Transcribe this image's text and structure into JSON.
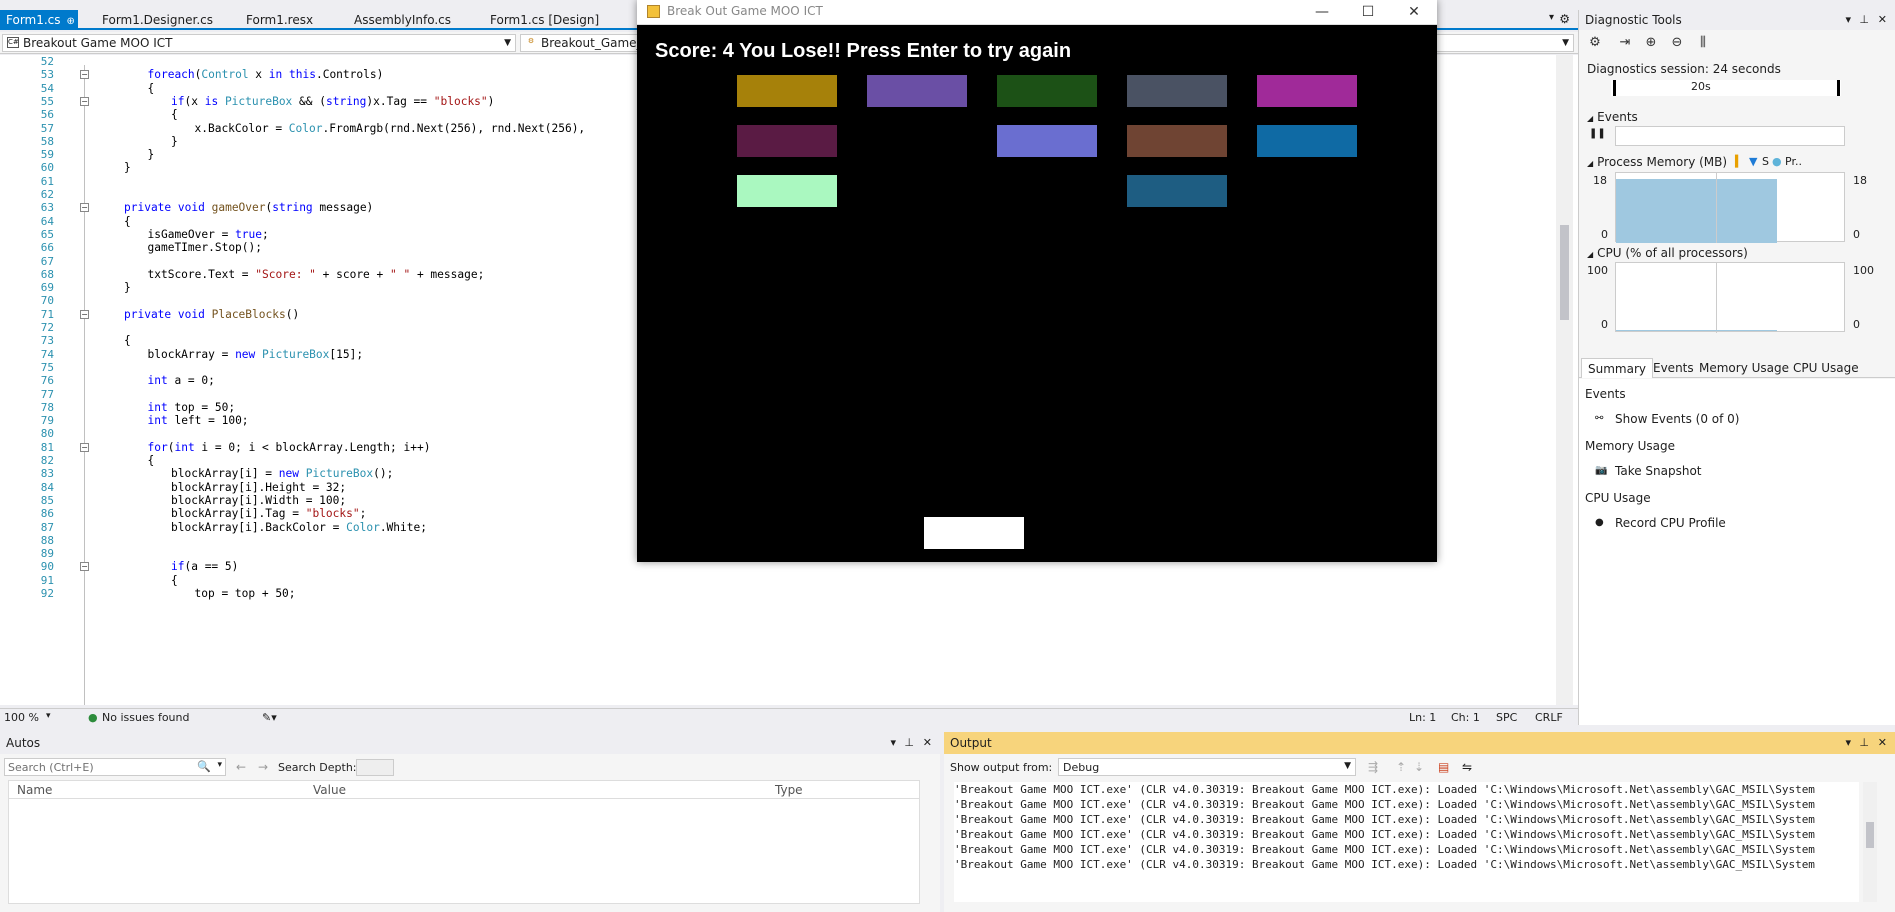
{
  "tabs": [
    {
      "label": "Form1.cs",
      "active": true
    },
    {
      "label": "Form1.Designer.cs"
    },
    {
      "label": "Form1.resx"
    },
    {
      "label": "AssemblyInfo.cs"
    },
    {
      "label": "Form1.cs [Design]"
    }
  ],
  "navbar": {
    "project": "Breakout Game MOO ICT",
    "class": "Breakout_Game_M"
  },
  "code_lines": [
    {
      "n": "52",
      "indent": 0,
      "html": ""
    },
    {
      "n": "53",
      "indent": 2,
      "html": "<span class='kw'>foreach</span>(<span class='ty'>Control</span> x <span class='kw'>in</span> <span class='kw'>this</span>.Controls)"
    },
    {
      "n": "54",
      "indent": 2,
      "html": "{"
    },
    {
      "n": "55",
      "indent": 3,
      "html": "<span class='kw'>if</span>(x <span class='kw'>is</span> <span class='ty'>PictureBox</span> &amp;&amp; (<span class='kw'>string</span>)x.Tag == <span class='st'>\"blocks\"</span>)"
    },
    {
      "n": "56",
      "indent": 3,
      "html": "{"
    },
    {
      "n": "57",
      "indent": 4,
      "html": "x.BackColor = <span class='ty'>Color</span>.FromArgb(rnd.Next(256), rnd.Next(256),"
    },
    {
      "n": "58",
      "indent": 3,
      "html": "}"
    },
    {
      "n": "59",
      "indent": 2,
      "html": "}"
    },
    {
      "n": "60",
      "indent": 1,
      "html": "}"
    },
    {
      "n": "61",
      "indent": 0,
      "html": ""
    },
    {
      "n": "62",
      "indent": 0,
      "html": ""
    },
    {
      "n": "63",
      "indent": 1,
      "html": "<span class='kw'>private</span> <span class='kw'>void</span> <span class='fn'>gameOver</span>(<span class='kw'>string</span> message)"
    },
    {
      "n": "64",
      "indent": 1,
      "html": "{"
    },
    {
      "n": "65",
      "indent": 2,
      "html": "isGameOver = <span class='kw'>true</span>;"
    },
    {
      "n": "66",
      "indent": 2,
      "html": "gameTImer.Stop();"
    },
    {
      "n": "67",
      "indent": 0,
      "html": ""
    },
    {
      "n": "68",
      "indent": 2,
      "html": "txtScore.Text = <span class='st'>\"Score: \"</span> + score + <span class='st'>\" \"</span> + message;"
    },
    {
      "n": "69",
      "indent": 1,
      "html": "}"
    },
    {
      "n": "70",
      "indent": 0,
      "html": ""
    },
    {
      "n": "71",
      "indent": 1,
      "html": "<span class='kw'>private</span> <span class='kw'>void</span> <span class='fn'>PlaceBlocks</span>()"
    },
    {
      "n": "72",
      "indent": 0,
      "html": ""
    },
    {
      "n": "73",
      "indent": 1,
      "html": "{"
    },
    {
      "n": "74",
      "indent": 2,
      "html": "blockArray = <span class='kw'>new</span> <span class='ty'>PictureBox</span>[15];"
    },
    {
      "n": "75",
      "indent": 0,
      "html": ""
    },
    {
      "n": "76",
      "indent": 2,
      "html": "<span class='kw'>int</span> a = 0;"
    },
    {
      "n": "77",
      "indent": 0,
      "html": ""
    },
    {
      "n": "78",
      "indent": 2,
      "html": "<span class='kw'>int</span> top = 50;"
    },
    {
      "n": "79",
      "indent": 2,
      "html": "<span class='kw'>int</span> left = 100;"
    },
    {
      "n": "80",
      "indent": 0,
      "html": ""
    },
    {
      "n": "81",
      "indent": 2,
      "html": "<span class='kw'>for</span>(<span class='kw'>int</span> i = 0; i &lt; blockArray.Length; i++)"
    },
    {
      "n": "82",
      "indent": 2,
      "html": "{"
    },
    {
      "n": "83",
      "indent": 3,
      "html": "blockArray[i] = <span class='kw'>new</span> <span class='ty'>PictureBox</span>();"
    },
    {
      "n": "84",
      "indent": 3,
      "html": "blockArray[i].Height = 32;"
    },
    {
      "n": "85",
      "indent": 3,
      "html": "blockArray[i].Width = 100;"
    },
    {
      "n": "86",
      "indent": 3,
      "html": "blockArray[i].Tag = <span class='st'>\"blocks\"</span>;"
    },
    {
      "n": "87",
      "indent": 3,
      "html": "blockArray[i].BackColor = <span class='ty'>Color</span>.White;"
    },
    {
      "n": "88",
      "indent": 0,
      "html": ""
    },
    {
      "n": "89",
      "indent": 0,
      "html": ""
    },
    {
      "n": "90",
      "indent": 3,
      "html": "<span class='kw'>if</span>(a == 5)"
    },
    {
      "n": "91",
      "indent": 3,
      "html": "{"
    },
    {
      "n": "92",
      "indent": 4,
      "html": "top = top + 50;"
    }
  ],
  "fold_markers": [
    "53",
    "55",
    "63",
    "71",
    "81",
    "90"
  ],
  "editor_status": {
    "zoom": "100 %",
    "issues": "No issues found",
    "ln": "Ln: 1",
    "ch": "Ch: 1",
    "spc": "SPC",
    "crlf": "CRLF"
  },
  "game": {
    "title": "Break Out Game MOO ICT",
    "score_text": "Score: 4 You Lose!! Press Enter to try again",
    "blocks": [
      {
        "row": 0,
        "col": 0,
        "color": "#a6810a"
      },
      {
        "row": 0,
        "col": 1,
        "color": "#6a4fa5"
      },
      {
        "row": 0,
        "col": 2,
        "color": "#1c5116"
      },
      {
        "row": 0,
        "col": 3,
        "color": "#4a5263"
      },
      {
        "row": 0,
        "col": 4,
        "color": "#a02a99"
      },
      {
        "row": 1,
        "col": 0,
        "color": "#5a1b44"
      },
      {
        "row": 1,
        "col": 2,
        "color": "#6a6ed0"
      },
      {
        "row": 1,
        "col": 3,
        "color": "#6f4433"
      },
      {
        "row": 1,
        "col": 4,
        "color": "#0f6aa4"
      },
      {
        "row": 2,
        "col": 0,
        "color": "#aaf8c0"
      },
      {
        "row": 2,
        "col": 3,
        "color": "#1e5d82"
      }
    ],
    "paddle_color": "#ffffff"
  },
  "diagnostics": {
    "title": "Diagnostic Tools",
    "session": "Diagnostics session: 24 seconds",
    "timeline_label": "20s",
    "events_label": "Events",
    "memory_label": "Process Memory (MB)",
    "memory_legend": [
      "S",
      "Pr.."
    ],
    "memory_max": "18",
    "memory_min": "0",
    "cpu_label": "CPU (% of all processors)",
    "cpu_max": "100",
    "cpu_min": "0",
    "tabs": [
      "Summary",
      "Events",
      "Memory Usage",
      "CPU Usage"
    ],
    "summary": [
      {
        "heading": "Events",
        "item": "Show Events (0 of 0)"
      },
      {
        "heading": "Memory Usage",
        "item": "Take Snapshot"
      },
      {
        "heading": "CPU Usage",
        "item": "Record CPU Profile"
      }
    ]
  },
  "autos": {
    "title": "Autos",
    "search_placeholder": "Search (Ctrl+E)",
    "search_depth": "Search Depth:",
    "columns": [
      "Name",
      "Value",
      "Type"
    ]
  },
  "output": {
    "title": "Output",
    "show_from_label": "Show output from:",
    "source": "Debug",
    "lines": [
      "'Breakout Game MOO ICT.exe' (CLR v4.0.30319: Breakout Game MOO ICT.exe): Loaded 'C:\\Windows\\Microsoft.Net\\assembly\\GAC_MSIL\\System",
      "'Breakout Game MOO ICT.exe' (CLR v4.0.30319: Breakout Game MOO ICT.exe): Loaded 'C:\\Windows\\Microsoft.Net\\assembly\\GAC_MSIL\\System",
      "'Breakout Game MOO ICT.exe' (CLR v4.0.30319: Breakout Game MOO ICT.exe): Loaded 'C:\\Windows\\Microsoft.Net\\assembly\\GAC_MSIL\\System",
      "'Breakout Game MOO ICT.exe' (CLR v4.0.30319: Breakout Game MOO ICT.exe): Loaded 'C:\\Windows\\Microsoft.Net\\assembly\\GAC_MSIL\\System",
      "'Breakout Game MOO ICT.exe' (CLR v4.0.30319: Breakout Game MOO ICT.exe): Loaded 'C:\\Windows\\Microsoft.Net\\assembly\\GAC_MSIL\\System",
      "'Breakout Game MOO ICT.exe' (CLR v4.0.30319: Breakout Game MOO ICT.exe): Loaded 'C:\\Windows\\Microsoft.Net\\assembly\\GAC_MSIL\\System"
    ]
  }
}
